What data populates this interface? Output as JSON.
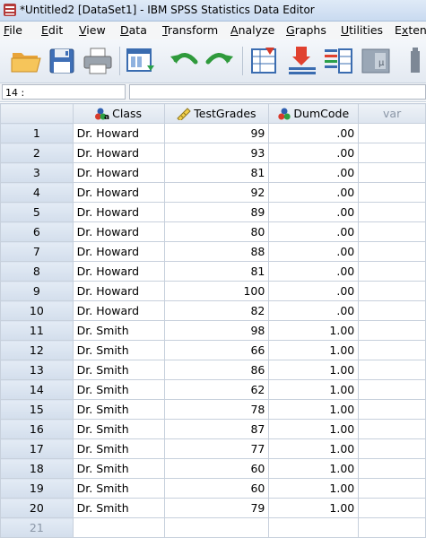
{
  "window": {
    "title": "*Untitled2 [DataSet1] - IBM SPSS Statistics Data Editor"
  },
  "menu": [
    {
      "label": "File",
      "u": "F",
      "rest": "ile"
    },
    {
      "label": "Edit",
      "u": "E",
      "rest": "dit"
    },
    {
      "label": "View",
      "u": "V",
      "rest": "iew"
    },
    {
      "label": "Data",
      "u": "D",
      "rest": "ata"
    },
    {
      "label": "Transform",
      "u": "T",
      "rest": "ransform"
    },
    {
      "label": "Analyze",
      "u": "A",
      "rest": "nalyze"
    },
    {
      "label": "Graphs",
      "u": "G",
      "rest": "raphs"
    },
    {
      "label": "Utilities",
      "u": "U",
      "rest": "tilities"
    },
    {
      "label": "Extens",
      "u": "x",
      "rest": "tens"
    }
  ],
  "toolbar": {
    "icons": [
      "open-folder-icon",
      "save-icon",
      "print-icon",
      "recall-dialog-icon",
      "undo-icon",
      "redo-icon",
      "goto-case-icon",
      "goto-variable-icon",
      "variables-icon",
      "split-file-icon",
      "weight-cases-icon"
    ]
  },
  "cellref": {
    "reference": "14 :",
    "value": ""
  },
  "grid": {
    "columns": [
      {
        "name": "Class",
        "icon": "nominal-icon"
      },
      {
        "name": "TestGrades",
        "icon": "scale-icon"
      },
      {
        "name": "DumCode",
        "icon": "nominal-icon"
      },
      {
        "name": "var",
        "icon": ""
      }
    ],
    "rows": [
      {
        "n": "1",
        "class": "Dr. Howard",
        "grade": "99",
        "dum": ".00"
      },
      {
        "n": "2",
        "class": "Dr. Howard",
        "grade": "93",
        "dum": ".00"
      },
      {
        "n": "3",
        "class": "Dr. Howard",
        "grade": "81",
        "dum": ".00"
      },
      {
        "n": "4",
        "class": "Dr. Howard",
        "grade": "92",
        "dum": ".00"
      },
      {
        "n": "5",
        "class": "Dr. Howard",
        "grade": "89",
        "dum": ".00"
      },
      {
        "n": "6",
        "class": "Dr. Howard",
        "grade": "80",
        "dum": ".00"
      },
      {
        "n": "7",
        "class": "Dr. Howard",
        "grade": "88",
        "dum": ".00"
      },
      {
        "n": "8",
        "class": "Dr. Howard",
        "grade": "81",
        "dum": ".00"
      },
      {
        "n": "9",
        "class": "Dr. Howard",
        "grade": "100",
        "dum": ".00"
      },
      {
        "n": "10",
        "class": "Dr. Howard",
        "grade": "82",
        "dum": ".00"
      },
      {
        "n": "11",
        "class": "Dr. Smith",
        "grade": "98",
        "dum": "1.00"
      },
      {
        "n": "12",
        "class": "Dr. Smith",
        "grade": "66",
        "dum": "1.00"
      },
      {
        "n": "13",
        "class": "Dr. Smith",
        "grade": "86",
        "dum": "1.00"
      },
      {
        "n": "14",
        "class": "Dr. Smith",
        "grade": "62",
        "dum": "1.00"
      },
      {
        "n": "15",
        "class": "Dr. Smith",
        "grade": "78",
        "dum": "1.00"
      },
      {
        "n": "16",
        "class": "Dr. Smith",
        "grade": "87",
        "dum": "1.00"
      },
      {
        "n": "17",
        "class": "Dr. Smith",
        "grade": "77",
        "dum": "1.00"
      },
      {
        "n": "18",
        "class": "Dr. Smith",
        "grade": "60",
        "dum": "1.00"
      },
      {
        "n": "19",
        "class": "Dr. Smith",
        "grade": "60",
        "dum": "1.00"
      },
      {
        "n": "20",
        "class": "Dr. Smith",
        "grade": "79",
        "dum": "1.00"
      }
    ],
    "empty_row": "21"
  }
}
